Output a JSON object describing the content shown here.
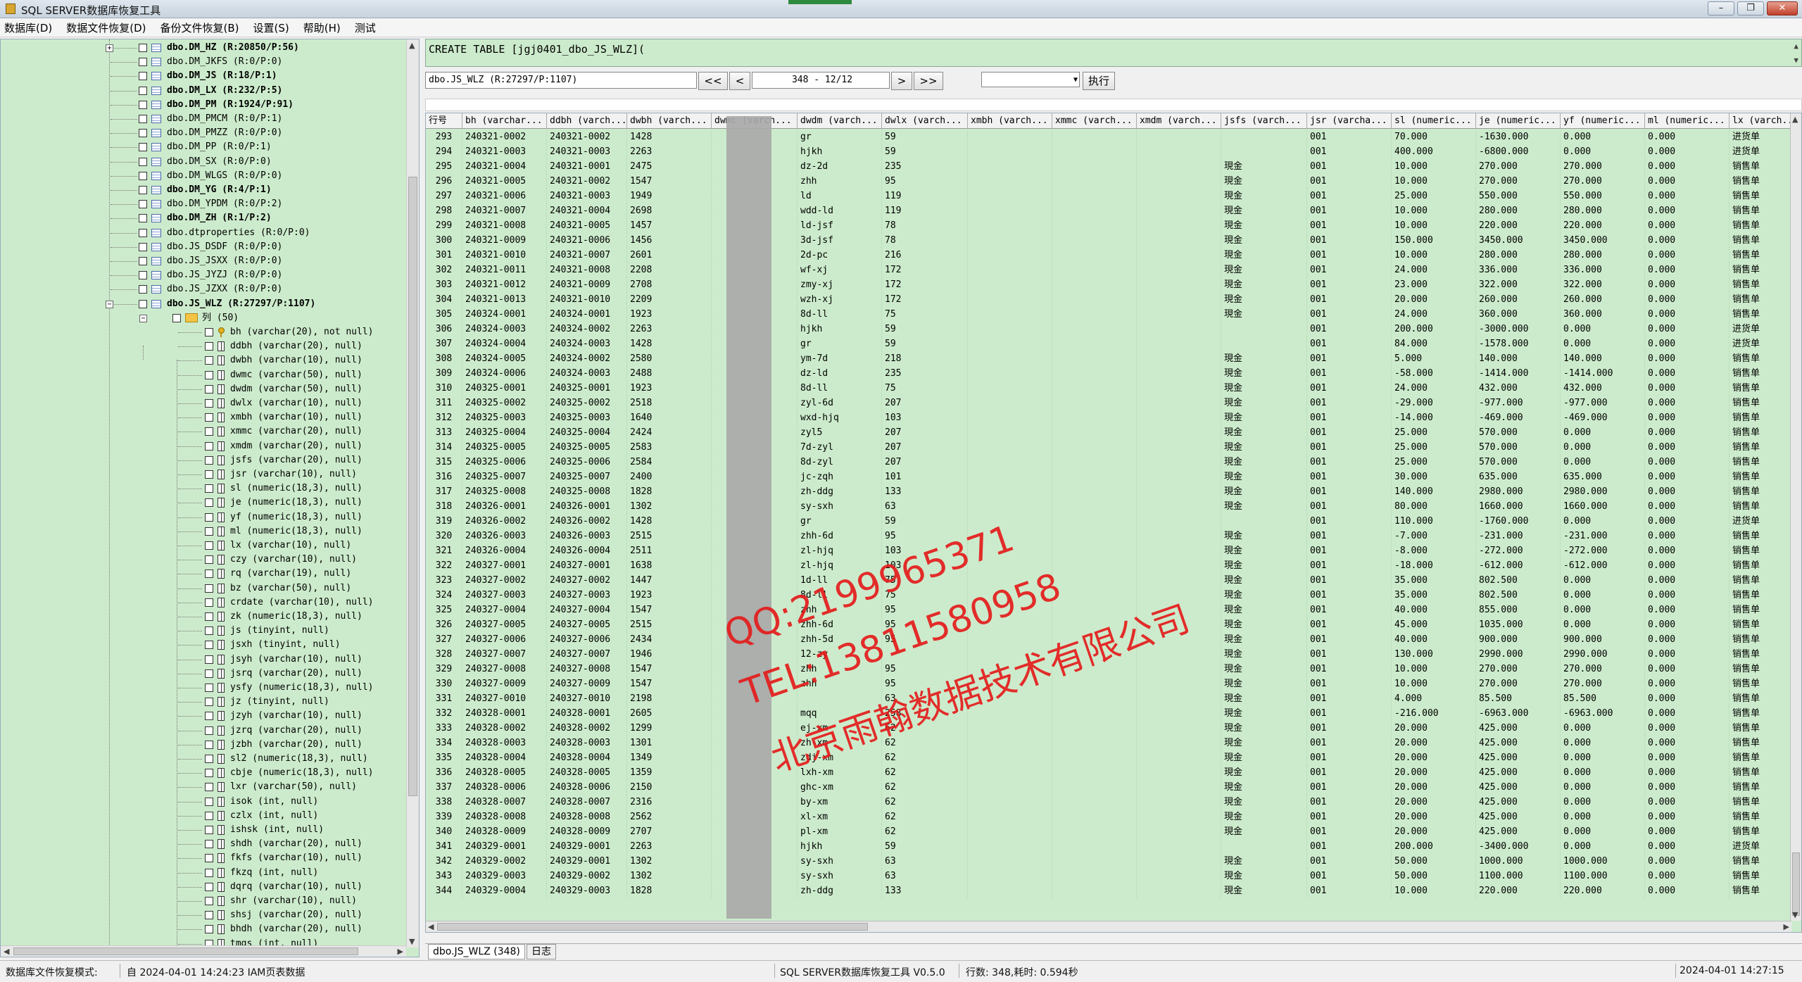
{
  "window": {
    "title": "SQL SERVER数据库恢复工具"
  },
  "menu": [
    "数据库(D)",
    "数据文件恢复(D)",
    "备份文件恢复(B)",
    "设置(S)",
    "帮助(H)",
    "测试"
  ],
  "tree": {
    "tables": [
      {
        "label": "dbo.DM_HZ (R:20850/P:56)",
        "bold": true
      },
      {
        "label": "dbo.DM_JKFS (R:0/P:0)",
        "bold": false
      },
      {
        "label": "dbo.DM_JS (R:18/P:1)",
        "bold": true
      },
      {
        "label": "dbo.DM_LX (R:232/P:5)",
        "bold": true
      },
      {
        "label": "dbo.DM_PM (R:1924/P:91)",
        "bold": true
      },
      {
        "label": "dbo.DM_PMCM (R:0/P:1)",
        "bold": false
      },
      {
        "label": "dbo.DM_PMZZ (R:0/P:0)",
        "bold": false
      },
      {
        "label": "dbo.DM_PP (R:0/P:1)",
        "bold": false
      },
      {
        "label": "dbo.DM_SX (R:0/P:0)",
        "bold": false
      },
      {
        "label": "dbo.DM_WLGS (R:0/P:0)",
        "bold": false
      },
      {
        "label": "dbo.DM_YG (R:4/P:1)",
        "bold": true
      },
      {
        "label": "dbo.DM_YPDM (R:0/P:2)",
        "bold": false
      },
      {
        "label": "dbo.DM_ZH (R:1/P:2)",
        "bold": true
      },
      {
        "label": "dbo.dtproperties (R:0/P:0)",
        "bold": false
      },
      {
        "label": "dbo.JS_DSDF (R:0/P:0)",
        "bold": false
      },
      {
        "label": "dbo.JS_JSXX (R:0/P:0)",
        "bold": false
      },
      {
        "label": "dbo.JS_JYZJ (R:0/P:0)",
        "bold": false
      },
      {
        "label": "dbo.JS_JZXX (R:0/P:0)",
        "bold": false
      },
      {
        "label": "dbo.JS_WLZ (R:27297/P:1107)",
        "bold": true
      }
    ],
    "folder_label": "列 (50)",
    "columns": [
      "bh (varchar(20), not null)",
      "ddbh (varchar(20), null)",
      "dwbh (varchar(10), null)",
      "dwmc (varchar(50), null)",
      "dwdm (varchar(50), null)",
      "dwlx (varchar(10), null)",
      "xmbh (varchar(10), null)",
      "xmmc (varchar(20), null)",
      "xmdm (varchar(20), null)",
      "jsfs (varchar(20), null)",
      "jsr (varchar(10), null)",
      "sl (numeric(18,3), null)",
      "je (numeric(18,3), null)",
      "yf (numeric(18,3), null)",
      "ml (numeric(18,3), null)",
      "lx (varchar(10), null)",
      "czy (varchar(10), null)",
      "rq (varchar(19), null)",
      "bz (varchar(50), null)",
      "crdate (varchar(10), null)",
      "zk (numeric(18,3), null)",
      "js (tinyint, null)",
      "jsxh (tinyint, null)",
      "jsyh (varchar(10), null)",
      "jsrq (varchar(20), null)",
      "ysfy (numeric(18,3), null)",
      "jz (tinyint, null)",
      "jzyh (varchar(10), null)",
      "jzrq (varchar(20), null)",
      "jzbh (varchar(20), null)",
      "sl2 (numeric(18,3), null)",
      "cbje (numeric(18,3), null)",
      "lxr (varchar(50), null)",
      "isok (int, null)",
      "czlx (int, null)",
      "ishsk (int, null)",
      "shdh (varchar(20), null)",
      "fkfs (varchar(10), null)",
      "fkzq (int, null)",
      "dqrq (varchar(10), null)",
      "shr (varchar(10), null)",
      "shsj (varchar(20), null)",
      "bhdh (varchar(20), null)",
      "tmgs (int, null)"
    ]
  },
  "sql_text": "CREATE TABLE [jgj0401_dbo_JS_WLZ](",
  "toolbar": {
    "table_label": "dbo.JS_WLZ (R:27297/P:1107)",
    "first": "<<",
    "prev": "<",
    "page": "348 - 12/12",
    "next": ">",
    "last": ">>",
    "exec": "执行"
  },
  "grid": {
    "headers": [
      "行号",
      "bh (varchar...",
      "ddbh (varch...",
      "dwbh (varch...",
      "dwmc (varch...",
      "dwdm (varch...",
      "dwlx (varch...",
      "xmbh (varch...",
      "xmmc (varch...",
      "xmdm (varch...",
      "jsfs (varch...",
      "jsr (varcha...",
      "sl (numeric...",
      "je (numeric...",
      "yf (numeric...",
      "ml (numeric...",
      "lx (varch..."
    ],
    "rows": [
      [
        "293",
        "240321-0002",
        "240321-0002",
        "1428",
        "",
        "gr",
        "59",
        "",
        "",
        "",
        "",
        "001",
        "70.000",
        "-1630.000",
        "0.000",
        "0.000",
        "进货单"
      ],
      [
        "294",
        "240321-0003",
        "240321-0003",
        "2263",
        "",
        "hjkh",
        "59",
        "",
        "",
        "",
        "",
        "001",
        "400.000",
        "-6800.000",
        "0.000",
        "0.000",
        "进货单"
      ],
      [
        "295",
        "240321-0004",
        "240321-0001",
        "2475",
        "",
        "dz-2d",
        "235",
        "",
        "",
        "",
        "現金",
        "001",
        "10.000",
        "270.000",
        "270.000",
        "0.000",
        "销售单"
      ],
      [
        "296",
        "240321-0005",
        "240321-0002",
        "1547",
        "",
        "zhh",
        "95",
        "",
        "",
        "",
        "現金",
        "001",
        "10.000",
        "270.000",
        "270.000",
        "0.000",
        "销售单"
      ],
      [
        "297",
        "240321-0006",
        "240321-0003",
        "1949",
        "",
        "ld",
        "119",
        "",
        "",
        "",
        "現金",
        "001",
        "25.000",
        "550.000",
        "550.000",
        "0.000",
        "销售单"
      ],
      [
        "298",
        "240321-0007",
        "240321-0004",
        "2698",
        "",
        "wdd-ld",
        "119",
        "",
        "",
        "",
        "現金",
        "001",
        "10.000",
        "280.000",
        "280.000",
        "0.000",
        "销售单"
      ],
      [
        "299",
        "240321-0008",
        "240321-0005",
        "1457",
        "",
        "ld-jsf",
        "78",
        "",
        "",
        "",
        "現金",
        "001",
        "10.000",
        "220.000",
        "220.000",
        "0.000",
        "销售单"
      ],
      [
        "300",
        "240321-0009",
        "240321-0006",
        "1456",
        "",
        "3d-jsf",
        "78",
        "",
        "",
        "",
        "現金",
        "001",
        "150.000",
        "3450.000",
        "3450.000",
        "0.000",
        "销售单"
      ],
      [
        "301",
        "240321-0010",
        "240321-0007",
        "2601",
        "",
        "2d-pc",
        "216",
        "",
        "",
        "",
        "現金",
        "001",
        "10.000",
        "280.000",
        "280.000",
        "0.000",
        "销售单"
      ],
      [
        "302",
        "240321-0011",
        "240321-0008",
        "2208",
        "",
        "wf-xj",
        "172",
        "",
        "",
        "",
        "現金",
        "001",
        "24.000",
        "336.000",
        "336.000",
        "0.000",
        "销售单"
      ],
      [
        "303",
        "240321-0012",
        "240321-0009",
        "2708",
        "",
        "zmy-xj",
        "172",
        "",
        "",
        "",
        "現金",
        "001",
        "23.000",
        "322.000",
        "322.000",
        "0.000",
        "销售单"
      ],
      [
        "304",
        "240321-0013",
        "240321-0010",
        "2209",
        "",
        "wzh-xj",
        "172",
        "",
        "",
        "",
        "現金",
        "001",
        "20.000",
        "260.000",
        "260.000",
        "0.000",
        "销售单"
      ],
      [
        "305",
        "240324-0001",
        "240324-0001",
        "1923",
        "",
        "8d-ll",
        "75",
        "",
        "",
        "",
        "現金",
        "001",
        "24.000",
        "360.000",
        "360.000",
        "0.000",
        "销售单"
      ],
      [
        "306",
        "240324-0003",
        "240324-0002",
        "2263",
        "",
        "hjkh",
        "59",
        "",
        "",
        "",
        "",
        "001",
        "200.000",
        "-3000.000",
        "0.000",
        "0.000",
        "进货单"
      ],
      [
        "307",
        "240324-0004",
        "240324-0003",
        "1428",
        "",
        "gr",
        "59",
        "",
        "",
        "",
        "",
        "001",
        "84.000",
        "-1578.000",
        "0.000",
        "0.000",
        "进货单"
      ],
      [
        "308",
        "240324-0005",
        "240324-0002",
        "2580",
        "",
        "ym-7d",
        "218",
        "",
        "",
        "",
        "現金",
        "001",
        "5.000",
        "140.000",
        "140.000",
        "0.000",
        "销售单"
      ],
      [
        "309",
        "240324-0006",
        "240324-0003",
        "2488",
        "",
        "dz-ld",
        "235",
        "",
        "",
        "",
        "現金",
        "001",
        "-58.000",
        "-1414.000",
        "-1414.000",
        "0.000",
        "销售单"
      ],
      [
        "310",
        "240325-0001",
        "240325-0001",
        "1923",
        "",
        "8d-ll",
        "75",
        "",
        "",
        "",
        "現金",
        "001",
        "24.000",
        "432.000",
        "432.000",
        "0.000",
        "销售单"
      ],
      [
        "311",
        "240325-0002",
        "240325-0002",
        "2518",
        "",
        "zyl-6d",
        "207",
        "",
        "",
        "",
        "現金",
        "001",
        "-29.000",
        "-977.000",
        "-977.000",
        "0.000",
        "销售单"
      ],
      [
        "312",
        "240325-0003",
        "240325-0003",
        "1640",
        "",
        "wxd-hjq",
        "103",
        "",
        "",
        "",
        "現金",
        "001",
        "-14.000",
        "-469.000",
        "-469.000",
        "0.000",
        "销售单"
      ],
      [
        "313",
        "240325-0004",
        "240325-0004",
        "2424",
        "",
        "zyl5",
        "207",
        "",
        "",
        "",
        "現金",
        "001",
        "25.000",
        "570.000",
        "0.000",
        "0.000",
        "销售单"
      ],
      [
        "314",
        "240325-0005",
        "240325-0005",
        "2583",
        "",
        "7d-zyl",
        "207",
        "",
        "",
        "",
        "現金",
        "001",
        "25.000",
        "570.000",
        "0.000",
        "0.000",
        "销售单"
      ],
      [
        "315",
        "240325-0006",
        "240325-0006",
        "2584",
        "",
        "8d-zyl",
        "207",
        "",
        "",
        "",
        "現金",
        "001",
        "25.000",
        "570.000",
        "0.000",
        "0.000",
        "销售单"
      ],
      [
        "316",
        "240325-0007",
        "240325-0007",
        "2400",
        "",
        "jc-zqh",
        "101",
        "",
        "",
        "",
        "現金",
        "001",
        "30.000",
        "635.000",
        "635.000",
        "0.000",
        "销售单"
      ],
      [
        "317",
        "240325-0008",
        "240325-0008",
        "1828",
        "",
        "zh-ddg",
        "133",
        "",
        "",
        "",
        "現金",
        "001",
        "140.000",
        "2980.000",
        "2980.000",
        "0.000",
        "销售单"
      ],
      [
        "318",
        "240326-0001",
        "240326-0001",
        "1302",
        "",
        "sy-sxh",
        "63",
        "",
        "",
        "",
        "現金",
        "001",
        "80.000",
        "1660.000",
        "1660.000",
        "0.000",
        "销售单"
      ],
      [
        "319",
        "240326-0002",
        "240326-0002",
        "1428",
        "",
        "gr",
        "59",
        "",
        "",
        "",
        "",
        "001",
        "110.000",
        "-1760.000",
        "0.000",
        "0.000",
        "进货单"
      ],
      [
        "320",
        "240326-0003",
        "240326-0003",
        "2515",
        "",
        "zhh-6d",
        "95",
        "",
        "",
        "",
        "現金",
        "001",
        "-7.000",
        "-231.000",
        "-231.000",
        "0.000",
        "销售单"
      ],
      [
        "321",
        "240326-0004",
        "240326-0004",
        "2511",
        "",
        "zl-hjq",
        "103",
        "",
        "",
        "",
        "現金",
        "001",
        "-8.000",
        "-272.000",
        "-272.000",
        "0.000",
        "销售单"
      ],
      [
        "322",
        "240327-0001",
        "240327-0001",
        "1638",
        "",
        "zl-hjq",
        "103",
        "",
        "",
        "",
        "現金",
        "001",
        "-18.000",
        "-612.000",
        "-612.000",
        "0.000",
        "销售单"
      ],
      [
        "323",
        "240327-0002",
        "240327-0002",
        "1447",
        "",
        "1d-ll",
        "75",
        "",
        "",
        "",
        "現金",
        "001",
        "35.000",
        "802.500",
        "0.000",
        "0.000",
        "销售单"
      ],
      [
        "324",
        "240327-0003",
        "240327-0003",
        "1923",
        "",
        "8d-ll",
        "75",
        "",
        "",
        "",
        "現金",
        "001",
        "35.000",
        "802.500",
        "0.000",
        "0.000",
        "销售单"
      ],
      [
        "325",
        "240327-0004",
        "240327-0004",
        "1547",
        "",
        "zhh",
        "95",
        "",
        "",
        "",
        "現金",
        "001",
        "40.000",
        "855.000",
        "0.000",
        "0.000",
        "销售单"
      ],
      [
        "326",
        "240327-0005",
        "240327-0005",
        "2515",
        "",
        "zhh-6d",
        "95",
        "",
        "",
        "",
        "現金",
        "001",
        "45.000",
        "1035.000",
        "0.000",
        "0.000",
        "销售单"
      ],
      [
        "327",
        "240327-0006",
        "240327-0006",
        "2434",
        "",
        "zhh-5d",
        "95",
        "",
        "",
        "",
        "現金",
        "001",
        "40.000",
        "900.000",
        "900.000",
        "0.000",
        "销售单"
      ],
      [
        "328",
        "240327-0007",
        "240327-0007",
        "1946",
        "",
        "12-zy",
        "",
        "",
        "",
        "",
        "現金",
        "001",
        "130.000",
        "2990.000",
        "2990.000",
        "0.000",
        "销售单"
      ],
      [
        "329",
        "240327-0008",
        "240327-0008",
        "1547",
        "",
        "zhh",
        "95",
        "",
        "",
        "",
        "現金",
        "001",
        "10.000",
        "270.000",
        "270.000",
        "0.000",
        "销售单"
      ],
      [
        "330",
        "240327-0009",
        "240327-0009",
        "1547",
        "",
        "zhh",
        "95",
        "",
        "",
        "",
        "現金",
        "001",
        "10.000",
        "270.000",
        "270.000",
        "0.000",
        "销售单"
      ],
      [
        "331",
        "240327-0010",
        "240327-0010",
        "2198",
        "",
        "",
        "63",
        "",
        "",
        "",
        "現金",
        "001",
        "4.000",
        "85.500",
        "85.500",
        "0.000",
        "销售单"
      ],
      [
        "332",
        "240328-0001",
        "240328-0001",
        "2605",
        "",
        "mqq",
        "258",
        "",
        "",
        "",
        "現金",
        "001",
        "-216.000",
        "-6963.000",
        "-6963.000",
        "0.000",
        "销售单"
      ],
      [
        "333",
        "240328-0002",
        "240328-0002",
        "1299",
        "",
        "ej-xm",
        "62",
        "",
        "",
        "",
        "現金",
        "001",
        "20.000",
        "425.000",
        "0.000",
        "0.000",
        "销售单"
      ],
      [
        "334",
        "240328-0003",
        "240328-0003",
        "1301",
        "",
        "zh-xm",
        "62",
        "",
        "",
        "",
        "現金",
        "001",
        "20.000",
        "425.000",
        "0.000",
        "0.000",
        "销售单"
      ],
      [
        "335",
        "240328-0004",
        "240328-0004",
        "1349",
        "",
        "zdj-xm",
        "62",
        "",
        "",
        "",
        "現金",
        "001",
        "20.000",
        "425.000",
        "0.000",
        "0.000",
        "销售单"
      ],
      [
        "336",
        "240328-0005",
        "240328-0005",
        "1359",
        "",
        "lxh-xm",
        "62",
        "",
        "",
        "",
        "現金",
        "001",
        "20.000",
        "425.000",
        "0.000",
        "0.000",
        "销售单"
      ],
      [
        "337",
        "240328-0006",
        "240328-0006",
        "2150",
        "",
        "ghc-xm",
        "62",
        "",
        "",
        "",
        "現金",
        "001",
        "20.000",
        "425.000",
        "0.000",
        "0.000",
        "销售单"
      ],
      [
        "338",
        "240328-0007",
        "240328-0007",
        "2316",
        "",
        "by-xm",
        "62",
        "",
        "",
        "",
        "現金",
        "001",
        "20.000",
        "425.000",
        "0.000",
        "0.000",
        "销售单"
      ],
      [
        "339",
        "240328-0008",
        "240328-0008",
        "2562",
        "",
        "xl-xm",
        "62",
        "",
        "",
        "",
        "現金",
        "001",
        "20.000",
        "425.000",
        "0.000",
        "0.000",
        "销售单"
      ],
      [
        "340",
        "240328-0009",
        "240328-0009",
        "2707",
        "",
        "pl-xm",
        "62",
        "",
        "",
        "",
        "現金",
        "001",
        "20.000",
        "425.000",
        "0.000",
        "0.000",
        "销售单"
      ],
      [
        "341",
        "240329-0001",
        "240329-0001",
        "2263",
        "",
        "hjkh",
        "59",
        "",
        "",
        "",
        "",
        "001",
        "200.000",
        "-3400.000",
        "0.000",
        "0.000",
        "进货单"
      ],
      [
        "342",
        "240329-0002",
        "240329-0001",
        "1302",
        "",
        "sy-sxh",
        "63",
        "",
        "",
        "",
        "現金",
        "001",
        "50.000",
        "1000.000",
        "1000.000",
        "0.000",
        "销售单"
      ],
      [
        "343",
        "240329-0003",
        "240329-0002",
        "1302",
        "",
        "sy-sxh",
        "63",
        "",
        "",
        "",
        "現金",
        "001",
        "50.000",
        "1100.000",
        "1100.000",
        "0.000",
        "销售单"
      ],
      [
        "344",
        "240329-0004",
        "240329-0003",
        "1828",
        "",
        "zh-ddg",
        "133",
        "",
        "",
        "",
        "現金",
        "001",
        "10.000",
        "220.000",
        "220.000",
        "0.000",
        "销售单"
      ]
    ]
  },
  "watermark": [
    "QQ:2199965371",
    "TEL:13811580958",
    "北京雨翰数据技术有限公司"
  ],
  "tabs": [
    "dbo.JS_WLZ (348)",
    "日志"
  ],
  "status": {
    "mode_label": "数据库文件恢复模式:",
    "mode_value": "自 2024-04-01 14:24:23 IAM页表数据",
    "app_version": "SQL SERVER数据库恢复工具 V0.5.0",
    "rows_info": "行数: 348,耗时: 0.594秒",
    "datetime": "2024-04-01 14:27:15"
  }
}
